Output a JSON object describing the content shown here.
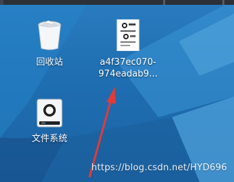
{
  "desktop": {
    "icons": [
      {
        "label": "回收站",
        "icon": "trash-icon"
      },
      {
        "label_lines": [
          "a4f37ec070-",
          "974eadab9..."
        ],
        "icon": "image-file-icon"
      },
      {
        "label": "文件系统",
        "icon": "drive-icon"
      }
    ]
  },
  "watermark": "https://blog.csdn.net/HYD696",
  "colors": {
    "background": "#1f6fb2",
    "arrow": "#e53935"
  }
}
